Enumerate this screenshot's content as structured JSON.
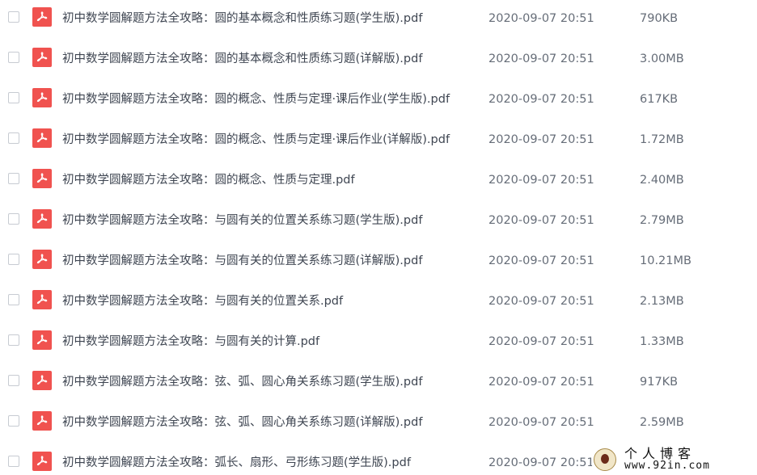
{
  "file_icon": "pdf-icon",
  "accent_color": "#f0524f",
  "files": [
    {
      "name": "初中数学圆解题方法全攻略：圆的基本概念和性质练习题(学生版).pdf",
      "date": "2020-09-07 20:51",
      "size": "790KB"
    },
    {
      "name": "初中数学圆解题方法全攻略：圆的基本概念和性质练习题(详解版).pdf",
      "date": "2020-09-07 20:51",
      "size": "3.00MB"
    },
    {
      "name": "初中数学圆解题方法全攻略：圆的概念、性质与定理·课后作业(学生版).pdf",
      "date": "2020-09-07 20:51",
      "size": "617KB"
    },
    {
      "name": "初中数学圆解题方法全攻略：圆的概念、性质与定理·课后作业(详解版).pdf",
      "date": "2020-09-07 20:51",
      "size": "1.72MB"
    },
    {
      "name": "初中数学圆解题方法全攻略：圆的概念、性质与定理.pdf",
      "date": "2020-09-07 20:51",
      "size": "2.40MB"
    },
    {
      "name": "初中数学圆解题方法全攻略：与圆有关的位置关系练习题(学生版).pdf",
      "date": "2020-09-07 20:51",
      "size": "2.79MB"
    },
    {
      "name": "初中数学圆解题方法全攻略：与圆有关的位置关系练习题(详解版).pdf",
      "date": "2020-09-07 20:51",
      "size": "10.21MB"
    },
    {
      "name": "初中数学圆解题方法全攻略：与圆有关的位置关系.pdf",
      "date": "2020-09-07 20:51",
      "size": "2.13MB"
    },
    {
      "name": "初中数学圆解题方法全攻略：与圆有关的计算.pdf",
      "date": "2020-09-07 20:51",
      "size": "1.33MB"
    },
    {
      "name": "初中数学圆解题方法全攻略：弦、弧、圆心角关系练习题(学生版).pdf",
      "date": "2020-09-07 20:51",
      "size": "917KB"
    },
    {
      "name": "初中数学圆解题方法全攻略：弦、弧、圆心角关系练习题(详解版).pdf",
      "date": "2020-09-07 20:51",
      "size": "2.59MB"
    },
    {
      "name": "初中数学圆解题方法全攻略：弧长、扇形、弓形练习题(学生版).pdf",
      "date": "2020-09-07 20:51",
      "size": ""
    }
  ],
  "watermark": {
    "title": "个人博客",
    "url": "www.92in.com"
  }
}
